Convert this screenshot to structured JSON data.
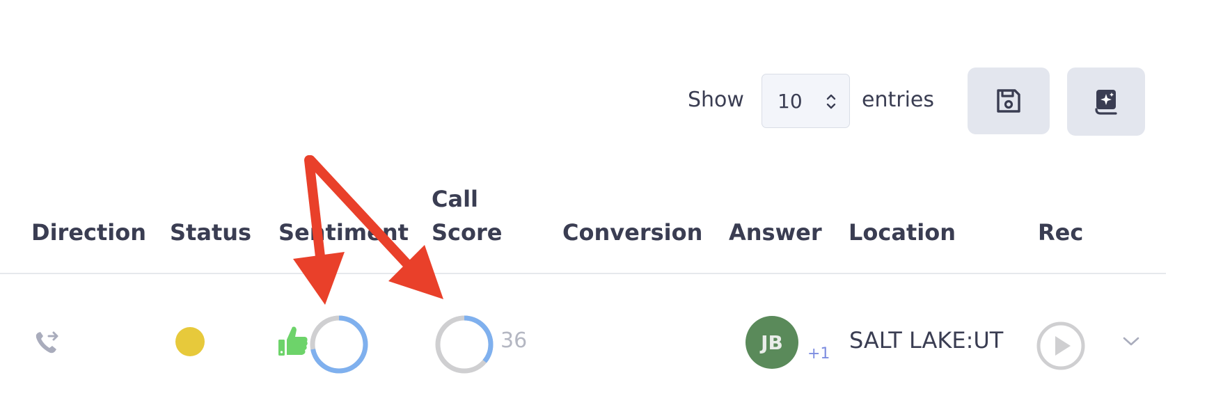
{
  "toolbar": {
    "show_label": "Show",
    "entries_value": "10",
    "entries_label": "entries",
    "save_icon": "floppy-disk-icon",
    "ai_icon": "sparkle-book-icon"
  },
  "table": {
    "columns": [
      "Direction",
      "Status",
      "Sentiment",
      "Call\nScore",
      "Conversion",
      "Answer",
      "Location",
      "Rec"
    ],
    "column_call_line1": "Call",
    "column_call_line2": "Score",
    "row": {
      "direction_icon": "phone-forward-icon",
      "status_color": "#e7c93b",
      "sentiment_icon": "thumbs-up-icon",
      "sentiment_ring_fraction": 0.72,
      "call_score_ring_fraction": 0.36,
      "call_score": "36",
      "answer_initials": "JB",
      "answer_extra": "+1",
      "location": "SALT LAKE:UT",
      "rec_icon": "play-icon",
      "expand_icon": "chevron-down-icon"
    }
  },
  "colors": {
    "text": "#3a3d52",
    "arrow": "#e9402a",
    "ring_accent": "#7fb0ee",
    "ring_base": "#cfcfd1",
    "thumbs": "#6dd36a",
    "avatar": "#5a8a5a"
  }
}
